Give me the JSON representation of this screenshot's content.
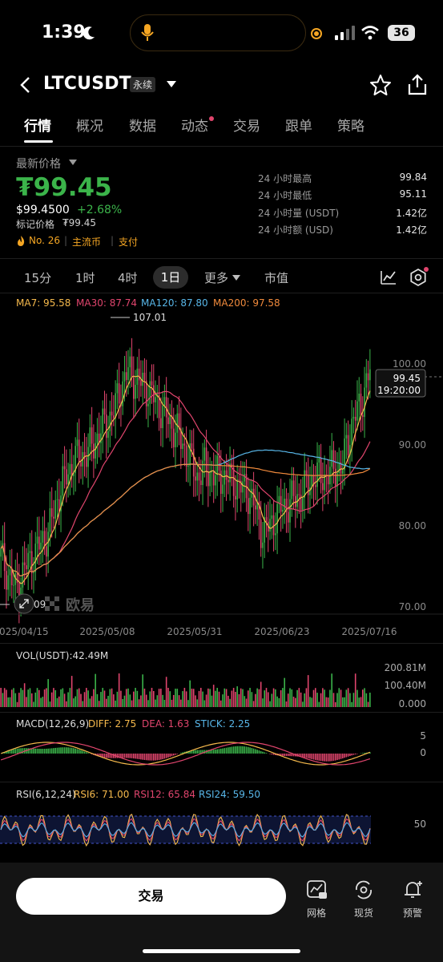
{
  "status": {
    "time": "1:39",
    "battery": "36"
  },
  "header": {
    "symbol": "LTCUSDT",
    "contract_type": "永续"
  },
  "tabs": [
    "行情",
    "概况",
    "数据",
    "动态",
    "交易",
    "跟单",
    "策略"
  ],
  "price": {
    "label": "最新价格",
    "main": "₮99.45",
    "usd": "$99.4500",
    "change": "+2.68%",
    "mark_label": "标记价格",
    "mark_value": "₮99.45",
    "rank": "No. 26",
    "tag1": "主流币",
    "tag2": "支付"
  },
  "stats": [
    {
      "label": "24 小时最高",
      "value": "99.84"
    },
    {
      "label": "24 小时最低",
      "value": "95.11"
    },
    {
      "label": "24 小时量 (USDT)",
      "value": "1.42亿"
    },
    {
      "label": "24 小时额 (USD)",
      "value": "1.42亿"
    }
  ],
  "timeframes": [
    "15分",
    "1时",
    "4时",
    "1日",
    "更多",
    "市值"
  ],
  "ma": {
    "ma7": "MA7: 95.58",
    "ma30": "MA30: 87.74",
    "ma120": "MA120: 87.80",
    "ma200": "MA200: 97.58"
  },
  "chart": {
    "y_ticks": [
      "100.00",
      "90.00",
      "80.00",
      "70.00"
    ],
    "x_ticks": [
      "2025/04/15",
      "2025/05/08",
      "2025/05/31",
      "2025/06/23",
      "2025/07/16"
    ],
    "high_label": "107.01",
    "low_label": "09",
    "current_price": "99.45",
    "countdown": "19:20:00",
    "watermark": "欧易"
  },
  "vol": {
    "label": "VOL(USDT):42.49M",
    "ticks": [
      "200.81M",
      "100.40M",
      "0.000"
    ]
  },
  "macd": {
    "label": "MACD(12,26,9)",
    "diff": "DIFF: 2.75",
    "dea": "DEA: 1.63",
    "stick": "STICK: 2.25",
    "ticks": [
      "5",
      "0"
    ]
  },
  "rsi": {
    "label": "RSI(6,12,24)",
    "rsi6": "RSI6: 71.00",
    "rsi12": "RSI12: 65.84",
    "rsi24": "RSI24: 59.50",
    "tick": "50"
  },
  "bottom": {
    "trade": "交易",
    "tools": [
      "网格",
      "现货",
      "预警"
    ]
  },
  "colors": {
    "up": "#3bb44a",
    "down": "#e0456d",
    "ma7": "#f5b94c",
    "ma30": "#e0456d",
    "ma120": "#58b6e8",
    "ma200": "#f08a3c"
  }
}
